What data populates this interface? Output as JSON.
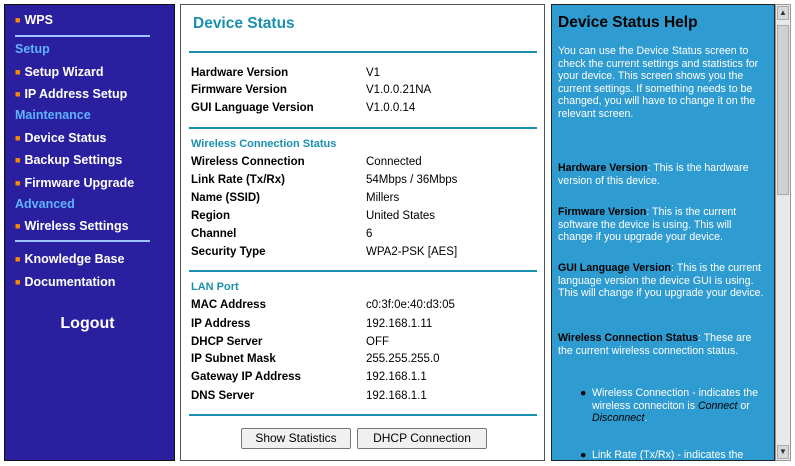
{
  "sidebar": {
    "wps": "WPS",
    "setup_heading": "Setup",
    "setup_wizard": "Setup Wizard",
    "ip_address_setup": "IP Address Setup",
    "maintenance_heading": "Maintenance",
    "device_status": "Device Status",
    "backup_settings": "Backup Settings",
    "firmware_upgrade": "Firmware Upgrade",
    "advanced_heading": "Advanced",
    "wireless_settings": "Wireless Settings",
    "knowledge_base": "Knowledge Base",
    "documentation": "Documentation",
    "logout": "Logout"
  },
  "main": {
    "title": "Device Status",
    "info": {
      "hardware_version_label": "Hardware Version",
      "hardware_version_value": "V1",
      "firmware_version_label": "Firmware Version",
      "firmware_version_value": "V1.0.0.21NA",
      "gui_language_label": "GUI Language Version",
      "gui_language_value": "V1.0.0.14"
    },
    "wireless": {
      "title": "Wireless Connection Status",
      "connection_label": "Wireless Connection",
      "connection_value": "Connected",
      "link_rate_label": "Link Rate (Tx/Rx)",
      "link_rate_value": "54Mbps / 36Mbps",
      "ssid_label": "Name (SSID)",
      "ssid_value": "Millers",
      "region_label": "Region",
      "region_value": "United States",
      "channel_label": "Channel",
      "channel_value": "6",
      "security_label": "Security Type",
      "security_value": "WPA2-PSK [AES]"
    },
    "lan": {
      "title": "LAN Port",
      "mac_label": "MAC Address",
      "mac_value": "c0:3f:0e:40:d3:05",
      "ip_label": "IP Address",
      "ip_value": "192.168.1.11",
      "dhcp_label": "DHCP Server",
      "dhcp_value": "OFF",
      "subnet_label": "IP Subnet Mask",
      "subnet_value": "255.255.255.0",
      "gateway_label": "Gateway IP Address",
      "gateway_value": "192.168.1.1",
      "dns_label": "DNS Server",
      "dns_value": "192.168.1.1"
    },
    "buttons": {
      "show_statistics": "Show Statistics",
      "dhcp_connection": "DHCP Connection"
    }
  },
  "help": {
    "title": "Device Status Help",
    "intro": "You can use the Device Status screen to check the current settings and statistics for your device. This screen shows you the current settings. If something needs to be changed, you will have to change it on the relevant screen.",
    "hw_term": "Hardware Version",
    "hw_text": ": This is the hardware version of this device.",
    "fw_term": "Firmware Version",
    "fw_text": ": This is the current software the device is using. This will change if you upgrade your device.",
    "gui_term": "GUI Language Version",
    "gui_text": ": This is the current language version the device GUI is using. This will change if you upgrade your device.",
    "wcs_term": "Wireless Connection Status",
    "wcs_text": ": These are the current wireless connection status.",
    "item1_text": "Wireless Connection - indicates the wireless conneciton is ",
    "item1_connect": "Connect",
    "item1_or": " or ",
    "item1_disconnect": "Disconnect",
    "item1_end": ".",
    "item2_text": "Link Rate (Tx/Rx) - indicates the"
  },
  "colors": {
    "sidebar_bg": "#2a1f9e",
    "section_heading": "#5fb3ff",
    "bullet": "#ff8a00",
    "accent_teal": "#1b8fae",
    "help_bg": "#2e9bd1"
  }
}
